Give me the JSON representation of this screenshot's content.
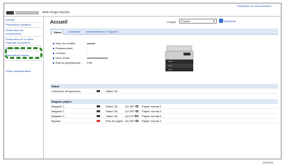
{
  "header": {
    "product_name": "Web Image Monitor",
    "help_link": "FAQ/Base de connaissance"
  },
  "sidebar": {
    "items": [
      {
        "label": "Accueil"
      },
      {
        "label": "Paramètres système"
      },
      {
        "label": "Destination de"
      },
      {
        "label": "numérisation"
      },
      {
        "label": "Destination de la carte"
      },
      {
        "label": "d'identité numérisée"
      },
      {
        "label": "Numériser vers"
      },
      {
        "label": "Paramètres réseau"
      },
      {
        "label": "Outils administrateur"
      }
    ]
  },
  "main": {
    "title": "Accueil",
    "language_label": "Langue",
    "language_value": "French",
    "refresh_label": "Rafraîchir",
    "tabs": [
      {
        "label": "Statut"
      },
      {
        "label": "Compteur"
      },
      {
        "label": "Informations sur l'appareil"
      }
    ],
    "info": [
      {
        "label": "Nom de modèle",
        "value": ""
      },
      {
        "label": "Emplacement",
        "value": ":"
      },
      {
        "label": "Contact",
        "value": ":"
      },
      {
        "label": "Nom d'hôte",
        "value": ""
      },
      {
        "label": "État du périphérique",
        "value": "Prêt"
      }
    ]
  },
  "status_section": {
    "header": "Statut",
    "rows": [
      {
        "item": "Cartouche d'impression",
        "status": "Statut OK"
      }
    ]
  },
  "paper_section": {
    "header": "Magasin papier",
    "rows": [
      {
        "tray": "Magasin 1",
        "status": "Statut OK",
        "size": "A4 SEF",
        "type": "Papier normal 2",
        "icon_color": "#3c3c3c"
      },
      {
        "tray": "Magasin 2",
        "status": "Statut OK",
        "size": "A4 SEF",
        "type": "Papier normal 2",
        "icon_color": "#3c3c3c"
      },
      {
        "tray": "Magasin 3",
        "status": "Statut OK",
        "size": "A4 LEF",
        "type": "Papier normal 2",
        "icon_color": "#3c3c3c"
      },
      {
        "tray": "Bypass",
        "status": "Plus de papier",
        "size": "A5 SEF",
        "type": "Papier normal 2",
        "icon_color": "#d9382e"
      }
    ]
  },
  "caption": "DZV493",
  "colors": {
    "link": "#2c53b7",
    "tab_bar": "#dde8f5",
    "highlight": "#2f8a28",
    "alert": "#d9382e"
  }
}
